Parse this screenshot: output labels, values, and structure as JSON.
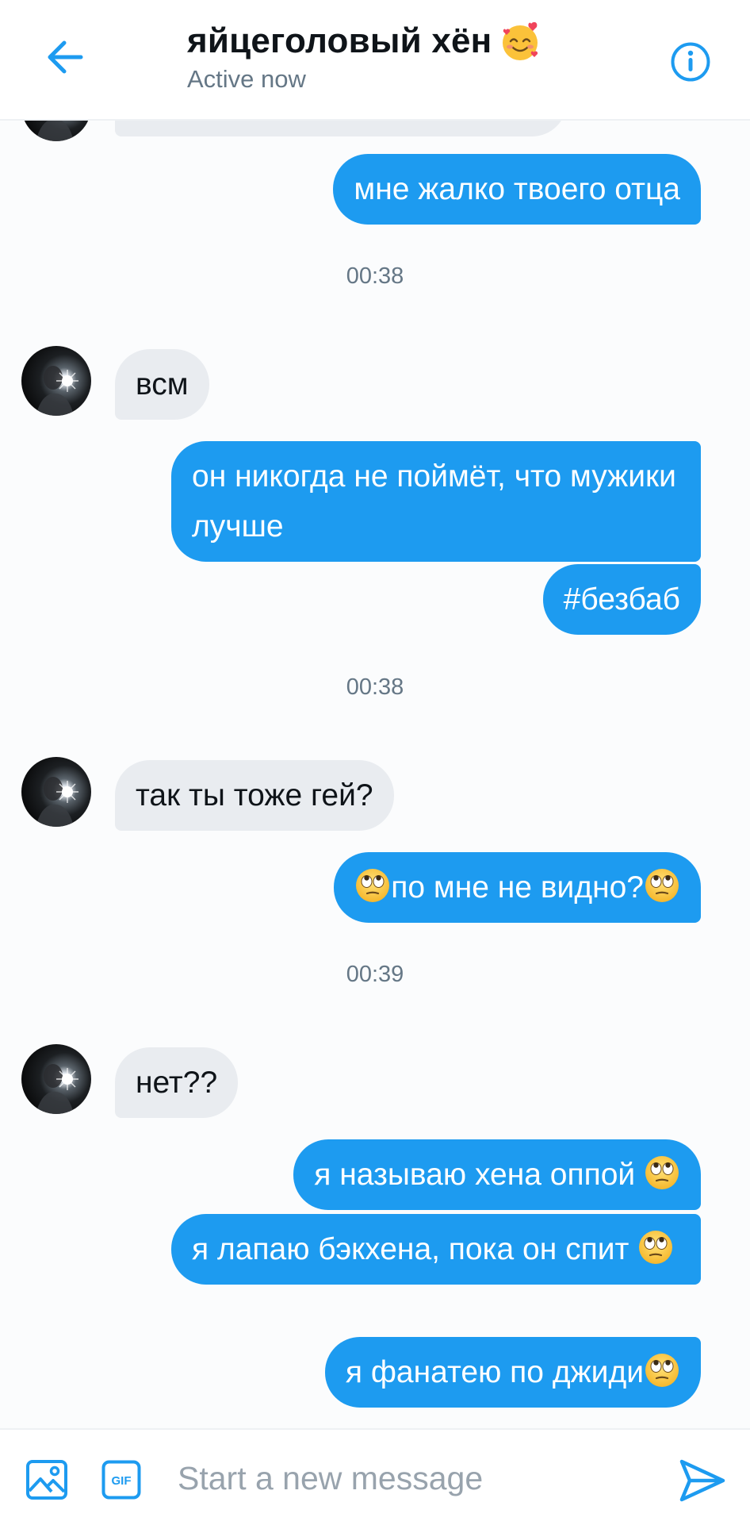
{
  "header": {
    "title": "яйцеголовый хён",
    "title_emoji": "smiling-face-with-hearts",
    "status": "Active now",
    "back_icon": "arrow-left-icon",
    "info_icon": "info-circle-icon"
  },
  "accent_color": "#1d9bf0",
  "received_bubble_color": "#e9ecf0",
  "messages": [
    {
      "direction": "sent",
      "text": "мне жалко твоего отца"
    },
    {
      "type": "timestamp",
      "text": "00:38"
    },
    {
      "direction": "received",
      "text": "всм"
    },
    {
      "direction": "sent",
      "text": "он никогда не поймёт, что мужики лучше"
    },
    {
      "direction": "sent",
      "text": "#безбаб"
    },
    {
      "type": "timestamp",
      "text": "00:38"
    },
    {
      "direction": "received",
      "text": "так ты тоже гей?"
    },
    {
      "direction": "sent",
      "text_before_emoji": "",
      "text": "по мне не видно?",
      "emoji": "face-with-rolling-eyes"
    },
    {
      "type": "timestamp",
      "text": "00:39"
    },
    {
      "direction": "received",
      "text": "нет??"
    },
    {
      "direction": "sent",
      "text": "я называю хена оппой ",
      "emoji": "face-with-rolling-eyes"
    },
    {
      "direction": "sent",
      "text": "я лапаю бэкхена, пока он спит ",
      "emoji": "face-with-rolling-eyes"
    },
    {
      "direction": "sent",
      "text": "я фанатею по джиди",
      "emoji": "face-with-rolling-eyes"
    }
  ],
  "composer": {
    "placeholder": "Start a new message",
    "media_icon": "image-icon",
    "gif_icon": "gif-icon",
    "gif_label": "GIF",
    "send_icon": "send-icon"
  }
}
